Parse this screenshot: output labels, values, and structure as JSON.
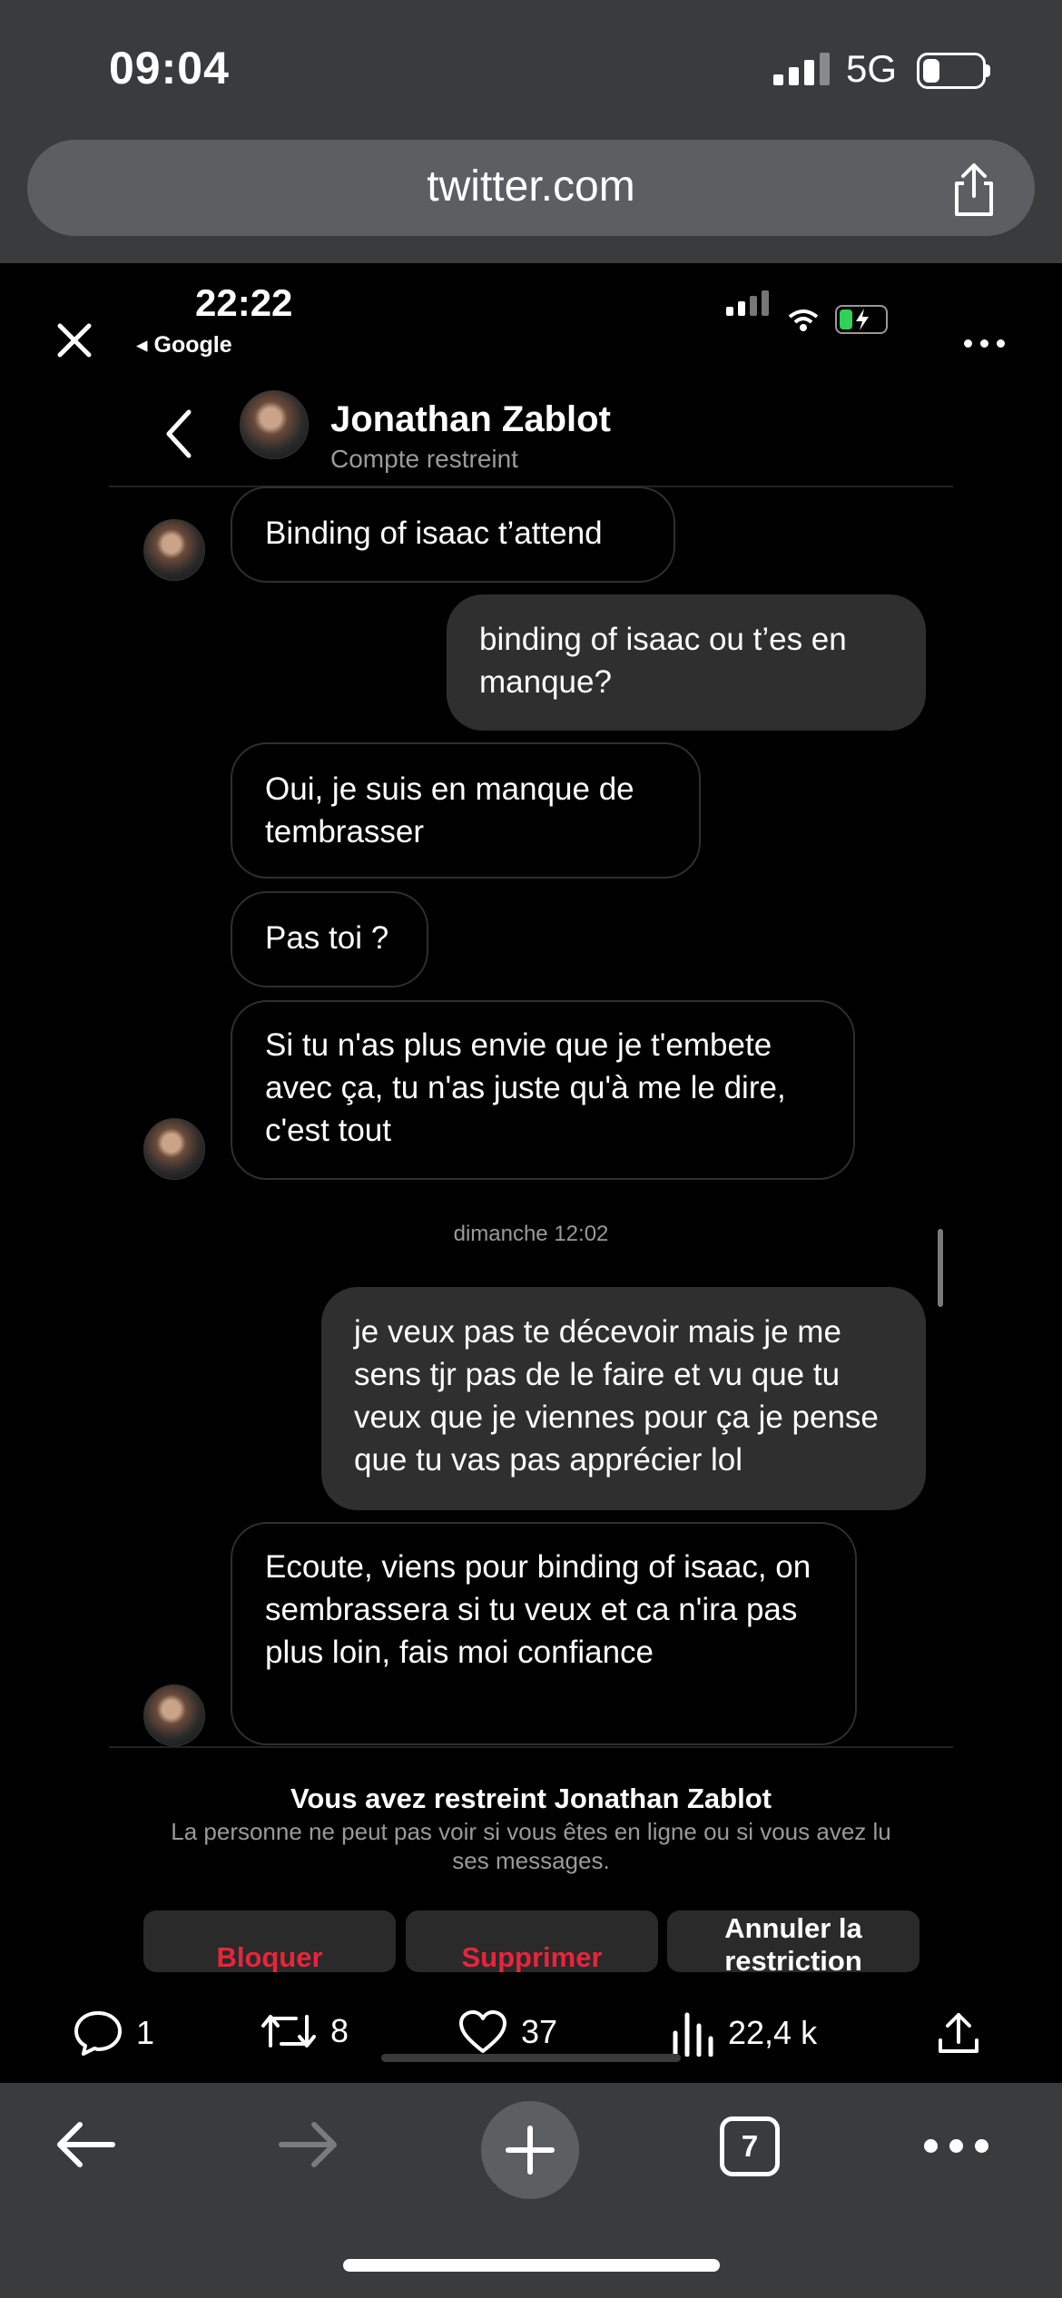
{
  "outer_status": {
    "time": "09:04",
    "network": "5G"
  },
  "browser": {
    "url": "twitter.com"
  },
  "inner_status": {
    "time": "22:22",
    "back_app": "◂ Google"
  },
  "chat": {
    "name": "Jonathan Zablot",
    "subtitle": "Compte restreint",
    "messages": [
      {
        "side": "in",
        "text": "Binding of isaac t’attend"
      },
      {
        "side": "out",
        "text": "binding of isaac ou t’es en manque?"
      },
      {
        "side": "in",
        "text": "Oui, je suis en manque de tembrasser"
      },
      {
        "side": "in",
        "text": "Pas toi ?"
      },
      {
        "side": "in",
        "text": "Si tu n'as plus envie que je t'embete avec ça, tu n'as juste qu'à me le dire, c'est tout"
      },
      {
        "side": "out",
        "text": "je veux pas te décevoir mais je me sens tjr pas de le faire et vu que tu veux que je viennes pour ça je pense que tu vas pas apprécier lol"
      },
      {
        "side": "in",
        "text": "Ecoute, viens pour binding of isaac, on sembrassera si tu veux et ca n'ira pas plus loin, fais moi confiance"
      }
    ],
    "day_stamp": "dimanche 12:02",
    "restriction_title": "Vous avez restreint Jonathan Zablot",
    "restriction_desc": "La personne ne peut pas voir si vous êtes en ligne ou si vous avez lu ses messages.",
    "buttons": {
      "block": "Bloquer",
      "delete": "Supprimer",
      "unrestrict": "Annuler la restriction"
    }
  },
  "tweet_actions": {
    "replies": "1",
    "retweets": "8",
    "likes": "37",
    "views": "22,4 k"
  },
  "bottom_bar": {
    "tabs_count": "7"
  },
  "icons": [
    "signal-icon",
    "battery-icon",
    "share-icon",
    "close-icon",
    "more-icon",
    "back-chevron-icon",
    "reply-icon",
    "retweet-icon",
    "like-icon",
    "views-icon",
    "upload-icon",
    "back-arrow-icon",
    "forward-arrow-icon",
    "new-tab-icon",
    "tabs-icon",
    "menu-icon"
  ],
  "colors": {
    "danger": "#e8253b",
    "toolbar": "#3a3b3d",
    "bubble_out": "#2f2f2f"
  }
}
